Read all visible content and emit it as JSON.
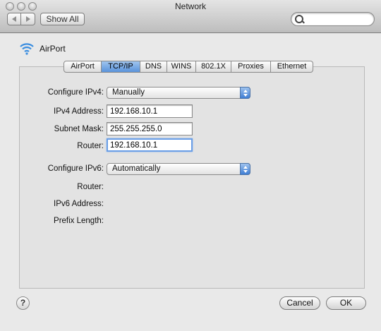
{
  "window": {
    "title": "Network"
  },
  "toolbar": {
    "show_all_label": "Show All",
    "search_placeholder": ""
  },
  "interface": {
    "name": "AirPort"
  },
  "tabs": [
    "AirPort",
    "TCP/IP",
    "DNS",
    "WINS",
    "802.1X",
    "Proxies",
    "Ethernet"
  ],
  "active_tab": "TCP/IP",
  "ipv4": {
    "configure_label": "Configure IPv4:",
    "configure_value": "Manually",
    "address_label": "IPv4 Address:",
    "address_value": "192.168.10.1",
    "subnet_label": "Subnet Mask:",
    "subnet_value": "255.255.255.0",
    "router_label": "Router:",
    "router_value": "192.168.10.1"
  },
  "ipv6": {
    "configure_label": "Configure IPv6:",
    "configure_value": "Automatically",
    "router_label": "Router:",
    "address_label": "IPv6 Address:",
    "prefix_label": "Prefix Length:"
  },
  "footer": {
    "help_label": "?",
    "cancel_label": "Cancel",
    "ok_label": "OK"
  },
  "icons": {
    "wifi": "wifi-icon",
    "search": "search-icon",
    "back": "back-arrow-icon",
    "forward": "forward-arrow-icon"
  },
  "colors": {
    "accent": "#5a93db",
    "focus_ring": "#6b9fe6"
  }
}
